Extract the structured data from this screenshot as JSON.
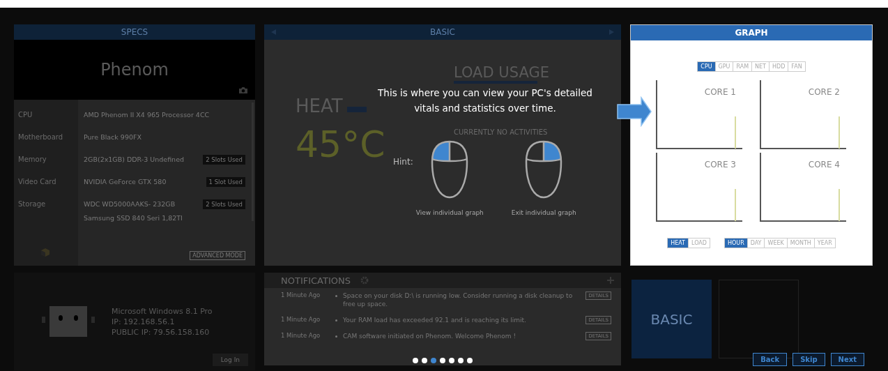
{
  "specs": {
    "title": "SPECS",
    "computer_name": "Phenom",
    "rows": [
      {
        "label": "CPU",
        "values": [
          "AMD Phenom II X4 965 Processor  4CC"
        ]
      },
      {
        "label": "Motherboard",
        "values": [
          "Pure Black 990FX"
        ]
      },
      {
        "label": "Memory",
        "values": [
          "2GB(2x1GB) DDR-3 Undefined"
        ],
        "badge": "2 Slots Used"
      },
      {
        "label": "Video Card",
        "values": [
          "NVIDIA GeForce GTX 580"
        ],
        "badge": "1 Slot Used"
      },
      {
        "label": "Storage",
        "values": [
          "WDC WD5000AAKS- 232GB",
          "Samsung SSD 840 Seri  1,82TI"
        ],
        "badge": "2 Slots Used"
      }
    ],
    "advanced_button": "ADVANCED MODE"
  },
  "basic": {
    "title": "BASIC",
    "heat_label": "HEAT",
    "temperature": "45°C",
    "load_label": "LOAD USAGE",
    "activity": "CURRENTLY NO ACTIVITIES"
  },
  "tour": {
    "message": "This is where you can view your PC's detailed vitals and statistics over time.",
    "hint": "Hint:",
    "hints": [
      {
        "kind": "left",
        "caption": "View individual graph"
      },
      {
        "kind": "right",
        "caption": "Exit individual graph"
      }
    ],
    "pager": [
      {
        "selected": false
      },
      {
        "selected": false
      },
      {
        "selected": true
      },
      {
        "selected": false
      },
      {
        "selected": false
      },
      {
        "selected": false
      },
      {
        "selected": false
      }
    ],
    "buttons": [
      "Back",
      "Skip",
      "Next"
    ]
  },
  "graph": {
    "title": "GRAPH",
    "sources": [
      {
        "label": "CPU",
        "selected": true
      },
      {
        "label": "GPU",
        "selected": false
      },
      {
        "label": "RAM",
        "selected": false
      },
      {
        "label": "NET",
        "selected": false
      },
      {
        "label": "HDD",
        "selected": false
      },
      {
        "label": "FAN",
        "selected": false
      }
    ],
    "charts": [
      {
        "title": "CORE 1"
      },
      {
        "title": "CORE 2"
      },
      {
        "title": "CORE 3"
      },
      {
        "title": "CORE 4"
      }
    ],
    "metrics": [
      {
        "label": "HEAT",
        "selected": true
      },
      {
        "label": "LOAD",
        "selected": false
      }
    ],
    "ranges": [
      {
        "label": "HOUR",
        "selected": true
      },
      {
        "label": "DAY",
        "selected": false
      },
      {
        "label": "WEEK",
        "selected": false
      },
      {
        "label": "MONTH",
        "selected": false
      },
      {
        "label": "YEAR",
        "selected": false
      }
    ]
  },
  "system": {
    "os": "Microsoft Windows 8.1 Pro",
    "ip": "IP: 192.168.56.1",
    "public_ip": "PUBLIC IP: 79.56.158.160",
    "login_button": "Log In"
  },
  "notifications": {
    "title": "NOTIFICATIONS",
    "items": [
      {
        "time": "1 Minute Ago",
        "message": "Space on your disk D:\\ is running low. Consider running a disk cleanup to free up space.",
        "button": "DETAILS"
      },
      {
        "time": "1 Minute Ago",
        "message": "Your RAM load has exceeded 92.1 and is reaching its limit.",
        "button": "DETAILS"
      },
      {
        "time": "1 Minute Ago",
        "message": "CAM software initiated on Phenom. Welcome Phenom !",
        "button": "DETAILS"
      }
    ]
  },
  "modes": [
    {
      "label": "BASIC",
      "selected": true
    },
    {
      "selected": false
    }
  ]
}
